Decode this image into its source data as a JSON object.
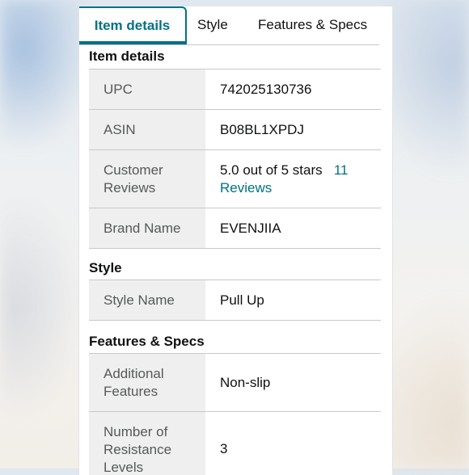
{
  "tabs": [
    {
      "label": "Item details",
      "active": true
    },
    {
      "label": "Style",
      "active": false
    },
    {
      "label": "Features & Specs",
      "active": false
    }
  ],
  "sections": {
    "item_details": {
      "title": "Item details",
      "rows": [
        {
          "label": "UPC",
          "value": "742025130736"
        },
        {
          "label": "ASIN",
          "value": "B08BL1XPDJ"
        },
        {
          "label": "Customer Reviews",
          "value": "5.0 out of 5 stars",
          "link": "11 Reviews"
        },
        {
          "label": "Brand Name",
          "value": "EVENJIIA"
        }
      ]
    },
    "style": {
      "title": "Style",
      "rows": [
        {
          "label": "Style Name",
          "value": "Pull Up"
        }
      ]
    },
    "features": {
      "title": "Features & Specs",
      "rows": [
        {
          "label": "Additional Features",
          "value": "Non-slip"
        },
        {
          "label": "Number of Resistance Levels",
          "value": "3"
        }
      ]
    }
  },
  "colors": {
    "accent": "#007185",
    "text": "#0f1111",
    "label_text": "#565959",
    "label_bg": "#efefef",
    "border": "#c9c9c9"
  }
}
